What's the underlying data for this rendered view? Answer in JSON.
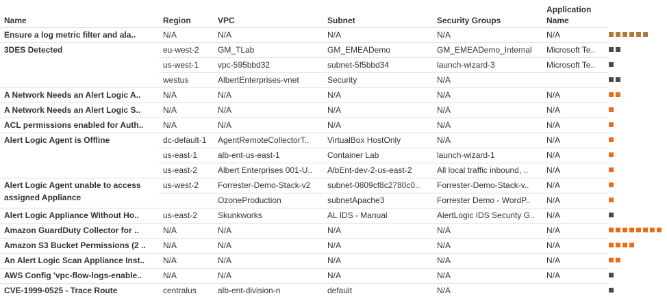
{
  "headers": {
    "name": "Name",
    "region": "Region",
    "vpc": "VPC",
    "subnet": "Subnet",
    "security_groups": "Security Groups",
    "application_name": "Application Name"
  },
  "colors": {
    "severity_low": "#4a4a4a",
    "severity_medium": "#ea6d1c",
    "severity_info": "#b07a3a",
    "divider": "#dcdcdc"
  },
  "groups": [
    {
      "name": "Ensure a log metric filter and ala..",
      "wrap": false,
      "rows": [
        {
          "region": "N/A",
          "vpc": "N/A",
          "subnet": "N/A",
          "sg": "N/A",
          "app": "N/A",
          "sev_count": 6,
          "sev_color": "brown"
        }
      ]
    },
    {
      "name": "3DES Detected",
      "wrap": false,
      "rows": [
        {
          "region": "eu-west-2",
          "vpc": "GM_TLab",
          "subnet": "GM_EMEADemo",
          "sg": "GM_EMEADemo_Internal",
          "app": "Microsoft Te..",
          "sev_count": 2,
          "sev_color": "dark"
        },
        {
          "region": "us-west-1",
          "vpc": "vpc-595bbd32",
          "subnet": "subnet-5f5bbd34",
          "sg": "launch-wizard-3",
          "app": "Microsoft Te..",
          "sev_count": 1,
          "sev_color": "dark"
        },
        {
          "region": "westus",
          "vpc": "AlbertEnterprises-vnet",
          "subnet": "Security",
          "sg": "N/A",
          "app": "",
          "sev_count": 2,
          "sev_color": "dark"
        }
      ]
    },
    {
      "name": "A Network Needs an Alert Logic A..",
      "wrap": false,
      "rows": [
        {
          "region": "N/A",
          "vpc": "N/A",
          "subnet": "N/A",
          "sg": "N/A",
          "app": "N/A",
          "sev_count": 2,
          "sev_color": "orange"
        }
      ]
    },
    {
      "name": "A Network Needs an Alert Logic S..",
      "wrap": false,
      "rows": [
        {
          "region": "N/A",
          "vpc": "N/A",
          "subnet": "N/A",
          "sg": "N/A",
          "app": "N/A",
          "sev_count": 1,
          "sev_color": "orange"
        }
      ]
    },
    {
      "name": "ACL permissions enabled for Auth..",
      "wrap": false,
      "rows": [
        {
          "region": "N/A",
          "vpc": "N/A",
          "subnet": "N/A",
          "sg": "N/A",
          "app": "N/A",
          "sev_count": 1,
          "sev_color": "orange"
        }
      ]
    },
    {
      "name": "Alert Logic Agent is Offline",
      "wrap": false,
      "rows": [
        {
          "region": "dc-default-1",
          "vpc": "AgentRemoteCollectorT..",
          "subnet": "VirtualBox HostOnly",
          "sg": "N/A",
          "app": "N/A",
          "sev_count": 1,
          "sev_color": "orange"
        },
        {
          "region": "us-east-1",
          "vpc": "alb-ent-us-east-1",
          "subnet": "Container Lab",
          "sg": "launch-wizard-1",
          "app": "N/A",
          "sev_count": 1,
          "sev_color": "orange"
        },
        {
          "region": "us-east-2",
          "vpc": "Albert Enterprises 001-U..",
          "subnet": "AlbEnt-dev-2-us-east-2",
          "sg": "All local traffic inbound, ..",
          "app": "N/A",
          "sev_count": 1,
          "sev_color": "orange"
        }
      ]
    },
    {
      "name": "Alert Logic Agent unable to access assigned Appliance",
      "wrap": true,
      "rows": [
        {
          "region": "us-west-2",
          "vpc": "Forrester-Demo-Stack-v2",
          "subnet": "subnet-0809cf8c2780c0..",
          "sg": "Forrester-Demo-Stack-v..",
          "app": "N/A",
          "sev_count": 1,
          "sev_color": "orange"
        },
        {
          "region": "",
          "vpc": "OzoneProduction",
          "subnet": "subnetApache3",
          "sg": "Forrester Demo - WordP..",
          "app": "N/A",
          "sev_count": 1,
          "sev_color": "orange"
        }
      ]
    },
    {
      "name": "Alert Logic Appliance Without Ho..",
      "wrap": false,
      "rows": [
        {
          "region": "us-east-2",
          "vpc": "Skunkworks",
          "subnet": "AL IDS - Manual",
          "sg": "AlertLogic IDS Security G..",
          "app": "N/A",
          "sev_count": 1,
          "sev_color": "dark"
        }
      ]
    },
    {
      "name": "Amazon GuardDuty Collector for ..",
      "wrap": false,
      "rows": [
        {
          "region": "N/A",
          "vpc": "N/A",
          "subnet": "N/A",
          "sg": "N/A",
          "app": "N/A",
          "sev_count": 8,
          "sev_color": "orange"
        }
      ]
    },
    {
      "name": "Amazon S3 Bucket Permissions (2 ..",
      "wrap": false,
      "rows": [
        {
          "region": "N/A",
          "vpc": "N/A",
          "subnet": "N/A",
          "sg": "N/A",
          "app": "N/A",
          "sev_count": 4,
          "sev_color": "orange"
        }
      ]
    },
    {
      "name": "An Alert Logic Scan Appliance Inst..",
      "wrap": false,
      "rows": [
        {
          "region": "N/A",
          "vpc": "N/A",
          "subnet": "N/A",
          "sg": "N/A",
          "app": "N/A",
          "sev_count": 2,
          "sev_color": "orange"
        }
      ]
    },
    {
      "name": "AWS Config 'vpc-flow-logs-enable..",
      "wrap": false,
      "rows": [
        {
          "region": "N/A",
          "vpc": "N/A",
          "subnet": "N/A",
          "sg": "N/A",
          "app": "N/A",
          "sev_count": 1,
          "sev_color": "dark"
        }
      ]
    },
    {
      "name": "CVE-1999-0525 - Trace Route",
      "wrap": false,
      "rows": [
        {
          "region": "centralus",
          "vpc": "alb-ent-division-n",
          "subnet": "default",
          "sg": "N/A",
          "app": "",
          "sev_count": 1,
          "sev_color": "dark"
        }
      ]
    }
  ]
}
